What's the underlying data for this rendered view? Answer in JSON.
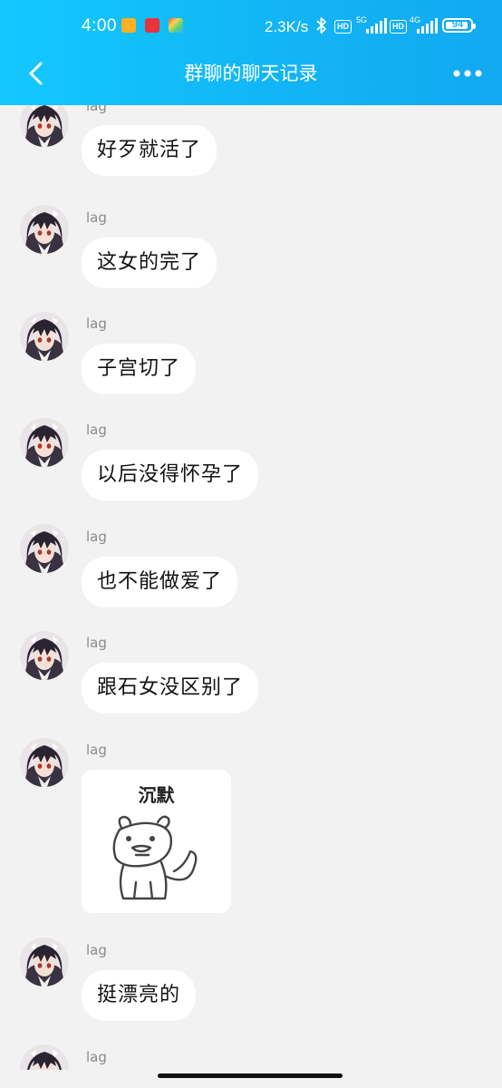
{
  "status_bar": {
    "time": "4:00",
    "net_speed": "2.3K/s",
    "hd1": "HD",
    "hd2": "HD",
    "sig1": "5G",
    "sig2": "4G",
    "battery": "94",
    "battery_level": 0.94
  },
  "header": {
    "title": "群聊的聊天记录"
  },
  "messages": [
    {
      "sender": "lag",
      "text": "好歹就活了"
    },
    {
      "sender": "lag",
      "text": "这女的完了"
    },
    {
      "sender": "lag",
      "text": "子宫切了"
    },
    {
      "sender": "lag",
      "text": "以后没得怀孕了"
    },
    {
      "sender": "lag",
      "text": "也不能做爱了"
    },
    {
      "sender": "lag",
      "text": "跟石女没区别了"
    },
    {
      "sender": "lag",
      "sticker_caption": "沉默"
    },
    {
      "sender": "lag",
      "text": "挺漂亮的"
    },
    {
      "sender": "lag"
    }
  ],
  "colors": {
    "accent": "#12b5f5",
    "background": "#f2f2f2",
    "bubble": "#ffffff"
  }
}
